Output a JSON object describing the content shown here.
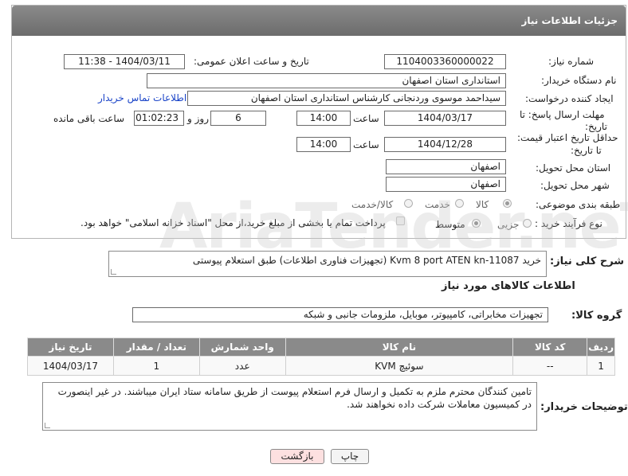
{
  "header": {
    "title": "جزئیات اطلاعات نیاز"
  },
  "form": {
    "need_number_label": "شماره نیاز:",
    "need_number": "1104003360000022",
    "announce_label": "تاریخ و ساعت اعلان عمومی:",
    "announce_value": "1404/03/11 - 11:38",
    "buyer_org_label": "نام دستگاه خریدار:",
    "buyer_org": "استانداری استان اصفهان",
    "requester_label": "ایجاد کننده درخواست:",
    "requester": "سیداحمد موسوی وردنجانی کارشناس استانداری استان اصفهان",
    "contact_link": "اطلاعات تماس خریدار",
    "deadline_label_1": "مهلت ارسال پاسخ: تا",
    "deadline_label_2": "تاریخ:",
    "deadline_date": "1404/03/17",
    "time_label": "ساعت",
    "deadline_time": "14:00",
    "days_value": "6",
    "days_label": "روز و",
    "remaining_value": "01:02:23",
    "remaining_label": "ساعت باقی مانده",
    "price_valid_label_1": "حداقل تاریخ اعتبار قیمت:",
    "price_valid_label_2": "تا تاریخ:",
    "price_valid_date": "1404/12/28",
    "price_valid_time": "14:00",
    "province_label": "استان محل تحویل:",
    "province": "اصفهان",
    "city_label": "شهر محل تحویل:",
    "city": "اصفهان",
    "category_label": "طبقه بندی موضوعی:",
    "category_options": [
      "کالا",
      "خدمت",
      "کالا/خدمت"
    ],
    "process_label": "نوع فرآیند خرید :",
    "process_options": [
      "جزیی",
      "متوسط"
    ],
    "payment_note": "پرداخت تمام یا بخشی از مبلغ خرید،از محل \"اسناد خزانه اسلامی\" خواهد بود."
  },
  "summary": {
    "label": "شرح کلی نیاز:",
    "text": "خرید Kvm 8 port ATEN kn-11087 (تجهیزات فناوری اطلاعات) طبق استعلام پیوستی"
  },
  "goods": {
    "title": "اطلاعات کالاهای مورد نیاز",
    "group_label": "گروه کالا:",
    "group_value": "تجهیزات مخابراتی، کامپیوتر، موبایل، ملزومات جانبی و شبکه",
    "columns": [
      "ردیف",
      "کد کالا",
      "نام کالا",
      "واحد شمارش",
      "تعداد / مقدار",
      "تاریخ نیاز"
    ],
    "rows": [
      [
        "1",
        "--",
        "سوئیچ KVM",
        "عدد",
        "1",
        "1404/03/17"
      ]
    ]
  },
  "buyer_notes": {
    "label": "توضیحات خریدار:",
    "text": "تامین کنندگان محترم ملزم به تکمیل و ارسال فرم استعلام پیوست از طریق سامانه ستاد ایران میباشند. در غیر اینصورت در کمیسیون معاملات شرکت داده نخواهند شد."
  },
  "buttons": {
    "print": "چاپ",
    "back": "بازگشت"
  },
  "watermark": "AriaTender.neT",
  "colors": {
    "header": "#7a7a7a",
    "link": "#1a44c8",
    "back_button": "#fde0e0"
  }
}
